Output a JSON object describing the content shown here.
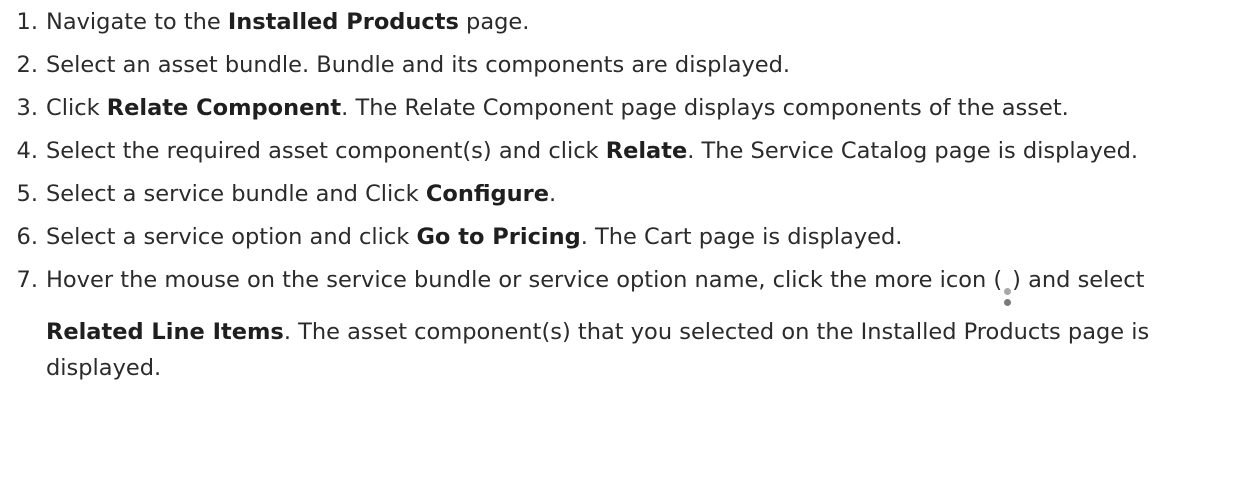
{
  "steps": [
    {
      "number": "1.",
      "parts": [
        "Navigate to the ",
        "Installed Products",
        " page."
      ]
    },
    {
      "number": "2.",
      "parts": [
        "Select an asset bundle. Bundle and its components are displayed."
      ]
    },
    {
      "number": "3.",
      "parts": [
        "Click ",
        "Relate Component",
        ". The Relate Component page displays components of the asset."
      ]
    },
    {
      "number": "4.",
      "parts": [
        "Select the required asset component(s) and click ",
        "Relate",
        ". The Service Catalog page is displayed."
      ]
    },
    {
      "number": "5.",
      "parts": [
        "Select a service bundle and Click ",
        "Configure",
        "."
      ]
    },
    {
      "number": "6.",
      "parts": [
        "Select a service option and click ",
        "Go to Pricing",
        ". The Cart page is displayed."
      ]
    },
    {
      "number": "7.",
      "parts": [
        "Hover the mouse on the service bundle or service option name, click the more icon (",
        ") and select ",
        "Related Line Items",
        ". The asset component(s) that you selected on the Installed Products page is displayed."
      ]
    }
  ],
  "icons": {
    "more": "more-vertical-icon"
  }
}
